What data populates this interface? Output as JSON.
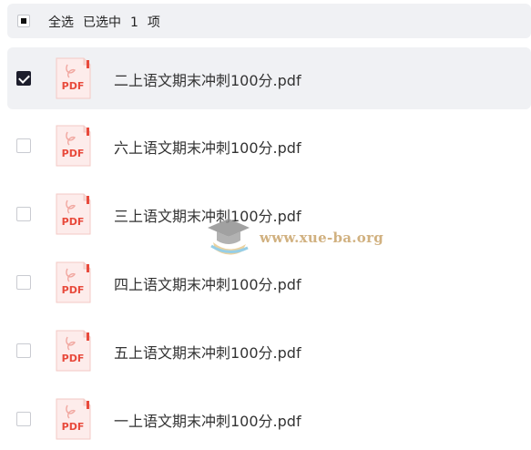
{
  "header": {
    "select_all_label": "全选",
    "selected_prefix": "已选中",
    "selected_count": "1",
    "selected_suffix": "项"
  },
  "files": [
    {
      "name": "二上语文期末冲刺100分.pdf",
      "checked": true,
      "icon": "pdf-icon",
      "badge": "PDF"
    },
    {
      "name": "六上语文期末冲刺100分.pdf",
      "checked": false,
      "icon": "pdf-icon",
      "badge": "PDF"
    },
    {
      "name": "三上语文期末冲刺100分.pdf",
      "checked": false,
      "icon": "pdf-icon",
      "badge": "PDF"
    },
    {
      "name": "四上语文期末冲刺100分.pdf",
      "checked": false,
      "icon": "pdf-icon",
      "badge": "PDF"
    },
    {
      "name": "五上语文期末冲刺100分.pdf",
      "checked": false,
      "icon": "pdf-icon",
      "badge": "PDF"
    },
    {
      "name": "一上语文期末冲刺100分.pdf",
      "checked": false,
      "icon": "pdf-icon",
      "badge": "PDF"
    }
  ],
  "watermark": {
    "text": "www.xue-ba.org"
  },
  "colors": {
    "pdf_red": "#e84a3c",
    "selected_bg": "#f0f1f4",
    "check_dark": "#1d1e2c"
  }
}
